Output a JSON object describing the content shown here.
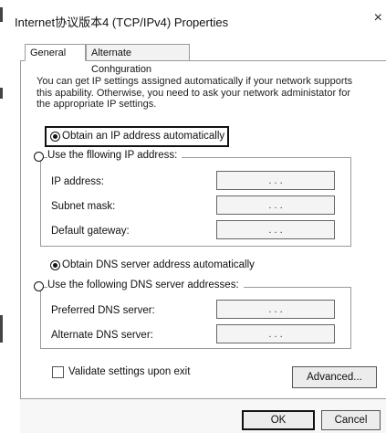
{
  "window": {
    "title": "Internet协议版本4 (TCP/IPv4) Properties",
    "close_glyph": "×"
  },
  "tabs": [
    {
      "label": "General",
      "active": true
    },
    {
      "label": "Alternate Conhguration",
      "active": false
    }
  ],
  "description": "You can get IP settings assigned automatically if your network supports this apability. Otherwise, you need to ask your network administator for the appropriate IP settings.",
  "ip_section": {
    "auto_option": "Obtain an IP address automatically",
    "manual_option": "Use the fllowing IP address:",
    "auto_selected": true,
    "fields": {
      "ip_address": {
        "label": "IP address:",
        "value": ". . ."
      },
      "subnet_mask": {
        "label": "Subnet mask:",
        "value": ". . ."
      },
      "default_gateway": {
        "label": "Default gateway:",
        "value": ". . ."
      }
    }
  },
  "dns_section": {
    "auto_option": "Obtain DNS server address automatically",
    "manual_option": "Use the following DNS server addresses:",
    "auto_selected": true,
    "fields": {
      "preferred": {
        "label": "Preferred DNS server:",
        "value": ". . ."
      },
      "alternate": {
        "label": "Alternate DNS server:",
        "value": ". . ."
      }
    }
  },
  "validate": {
    "label": "Validate settings upon exit",
    "checked": false
  },
  "buttons": {
    "advanced": "Advanced...",
    "ok": "OK",
    "cancel": "Cancel"
  },
  "colors": {
    "border": "#9a9a9a",
    "highlight": "#111111",
    "field_bg": "#f4f4f4"
  }
}
